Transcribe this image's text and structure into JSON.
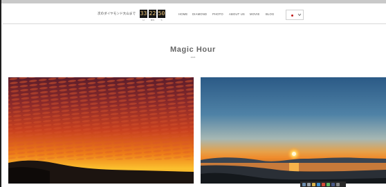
{
  "header": {
    "countdown_label": "次のダイヤモンド大山まで",
    "countdown": [
      {
        "value": "33",
        "unit": "H"
      },
      {
        "value": "22",
        "unit": "MIN"
      },
      {
        "value": "50",
        "unit": "S"
      }
    ],
    "nav": [
      "HOME",
      "DIAMOND",
      "PHOTO",
      "ABOUT US",
      "MOVIE",
      "BLOG"
    ],
    "language": "Japanese flag"
  },
  "main": {
    "title": "Magic Hour",
    "subtitle": "2023"
  },
  "photos": [
    {
      "name": "sunset-sky-red-clouds"
    },
    {
      "name": "sunset-over-bay"
    }
  ],
  "colors": {
    "accent": "#f2c879",
    "timer_bg": "#141414",
    "flag_red": "#c01818"
  }
}
